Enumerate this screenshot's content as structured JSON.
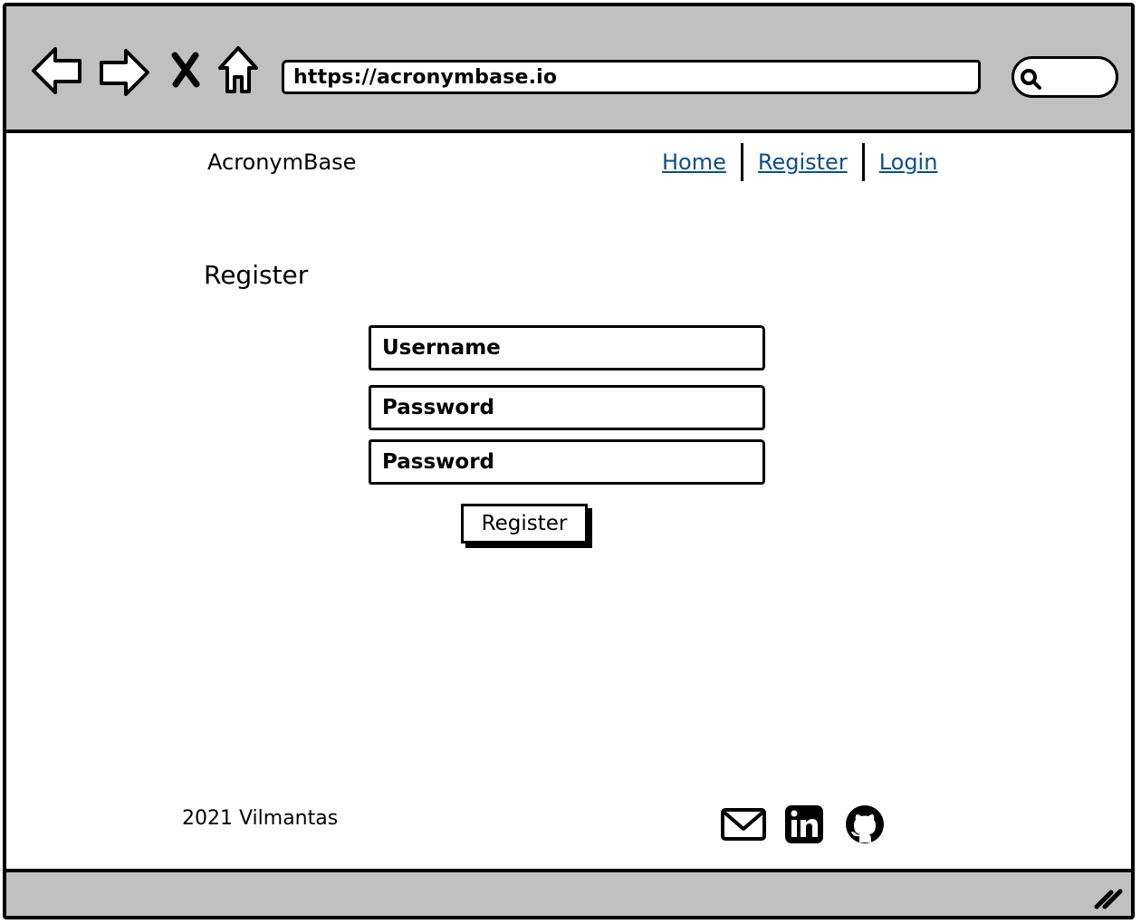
{
  "browser": {
    "url": "https://acronymbase.io",
    "icons": [
      "back-arrow-icon",
      "forward-arrow-icon",
      "close-icon",
      "home-icon",
      "search-icon",
      "resize-grip-icon"
    ]
  },
  "header": {
    "brand": "AcronymBase",
    "nav": [
      {
        "label": "Home"
      },
      {
        "label": "Register"
      },
      {
        "label": "Login"
      }
    ]
  },
  "main": {
    "heading": "Register",
    "fields": [
      {
        "label": "Username"
      },
      {
        "label": "Password"
      },
      {
        "label": "Password"
      }
    ],
    "submit_label": "Register"
  },
  "footer": {
    "copyright": "2021 Vilmantas",
    "social_icons": [
      "mail-icon",
      "linkedin-icon",
      "github-icon"
    ]
  },
  "colors": {
    "chrome": "#c0c0c0",
    "link": "#0b4f8c"
  }
}
